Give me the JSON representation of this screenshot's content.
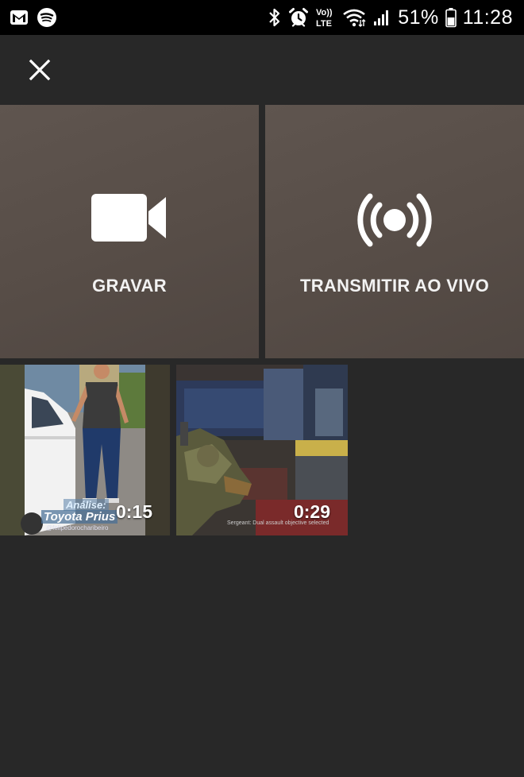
{
  "status_bar": {
    "battery": "51%",
    "time": "11:28",
    "icons": [
      "gmail-icon",
      "spotify-icon",
      "bluetooth-icon",
      "alarm-icon",
      "volte-icon",
      "wifi-icon",
      "signal-icon",
      "battery-icon"
    ],
    "volte_label": "Vo))\nLTE"
  },
  "header": {
    "close_icon": "close-icon"
  },
  "actions": [
    {
      "label": "GRAVAR",
      "icon": "video-camera-icon"
    },
    {
      "label": "TRANSMITIR AO VIVO",
      "icon": "live-broadcast-icon"
    }
  ],
  "videos": [
    {
      "duration": "0:15",
      "overlay_line1": "Análise:",
      "overlay_line2": "Toyota Prius",
      "overlay_line3": "@felipedorocharibeiro"
    },
    {
      "duration": "0:29",
      "subtitle": "Sergeant: Dual assault objective selected"
    }
  ],
  "colors": {
    "background": "#282828",
    "status_bar": "#000000",
    "tile": "#5a504a"
  }
}
